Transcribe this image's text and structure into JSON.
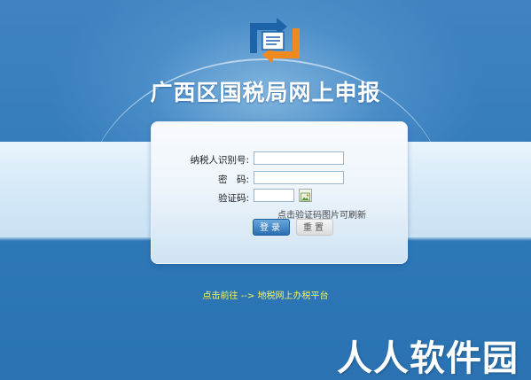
{
  "header": {
    "title": "广西区国税局网上申报",
    "logo_icon": "double-arrow-document-logo-icon"
  },
  "login": {
    "taxpayer_id_label": "纳税人识别号:",
    "taxpayer_id_value": "",
    "password_label": "密　码:",
    "password_value": "",
    "captcha_label": "验证码:",
    "captcha_value": "",
    "captcha_image_icon": "captcha-image-icon",
    "captcha_hint": "点击验证码图片可刷新",
    "login_button": "登录",
    "reset_button": "重置"
  },
  "footer": {
    "link_text": "点击前往 --> 地税网上办税平台"
  },
  "watermark": {
    "text": "人人软件园"
  },
  "colors": {
    "background": "#2f78b8",
    "band": "#d5e9f7",
    "login_button": "#2a6eb2",
    "footer_link": "#f3f35a"
  }
}
